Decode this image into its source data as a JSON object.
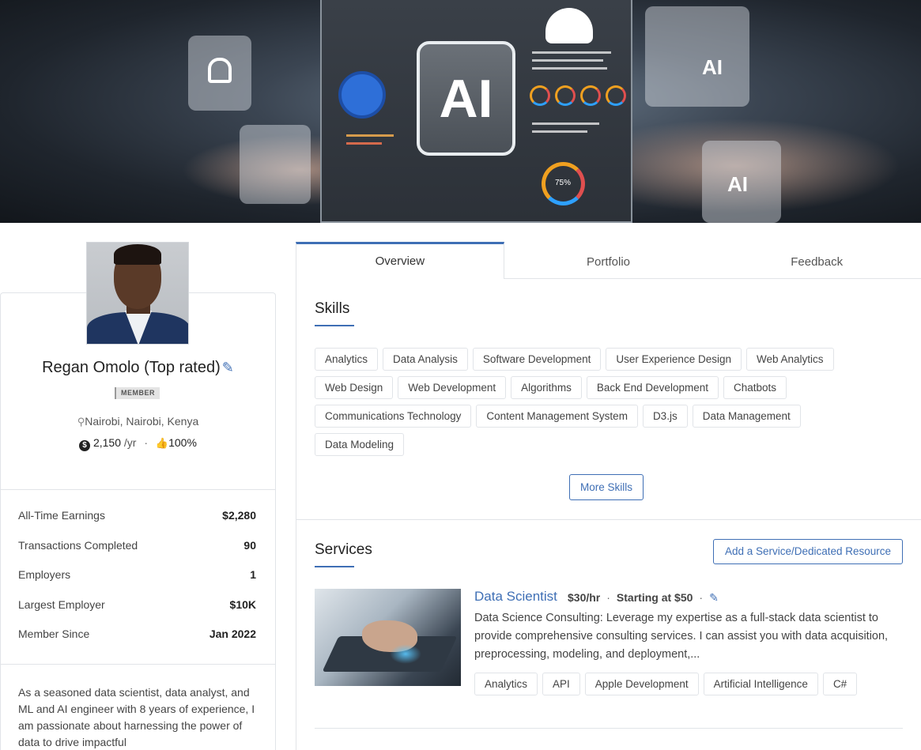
{
  "profile": {
    "name": "Regan Omolo (Top rated)",
    "badge": "MEMBER",
    "location": "Nairobi, Nairobi, Kenya",
    "earnings_rate": "2,150",
    "earnings_unit": "/yr",
    "rating": "100%"
  },
  "stats": [
    {
      "label": "All-Time Earnings",
      "value": "$2,280"
    },
    {
      "label": "Transactions Completed",
      "value": "90"
    },
    {
      "label": "Employers",
      "value": "1"
    },
    {
      "label": "Largest Employer",
      "value": "$10K"
    },
    {
      "label": "Member Since",
      "value": "Jan 2022"
    }
  ],
  "bio": "As a seasoned data scientist, data analyst, and ML and AI engineer with 8 years of experience, I am passionate about harnessing the power of data to drive impactful",
  "tabs": [
    {
      "label": "Overview"
    },
    {
      "label": "Portfolio"
    },
    {
      "label": "Feedback"
    }
  ],
  "skills": {
    "title": "Skills",
    "items": [
      "Analytics",
      "Data Analysis",
      "Software Development",
      "User Experience Design",
      "Web Analytics",
      "Web Design",
      "Web Development",
      "Algorithms",
      "Back End Development",
      "Chatbots",
      "Communications Technology",
      "Content Management System",
      "D3.js",
      "Data Management",
      "Data Modeling"
    ],
    "more_label": "More Skills"
  },
  "services": {
    "title": "Services",
    "add_label": "Add a Service/Dedicated Resource",
    "items": [
      {
        "title": "Data Scientist",
        "rate": "$30/hr",
        "starting": "Starting at $50",
        "description": "Data Science Consulting: Leverage my expertise as a full-stack data scientist to provide comprehensive consulting services. I can assist you with data acquisition, preprocessing, modeling, and deployment,...",
        "tags": [
          "Analytics",
          "API",
          "Apple Development",
          "Artificial Intelligence",
          "C#"
        ]
      }
    ]
  },
  "banner": {
    "ai_label": "AI",
    "donut_label": "75%"
  },
  "icons": {
    "pin": "map-pin-icon",
    "coin": "dollar-coin-icon",
    "thumb": "thumbs-up-icon",
    "edit": "pencil-icon"
  },
  "colors": {
    "accent": "#3f6fb5",
    "border": "#e1e4e8",
    "text": "#333333"
  }
}
